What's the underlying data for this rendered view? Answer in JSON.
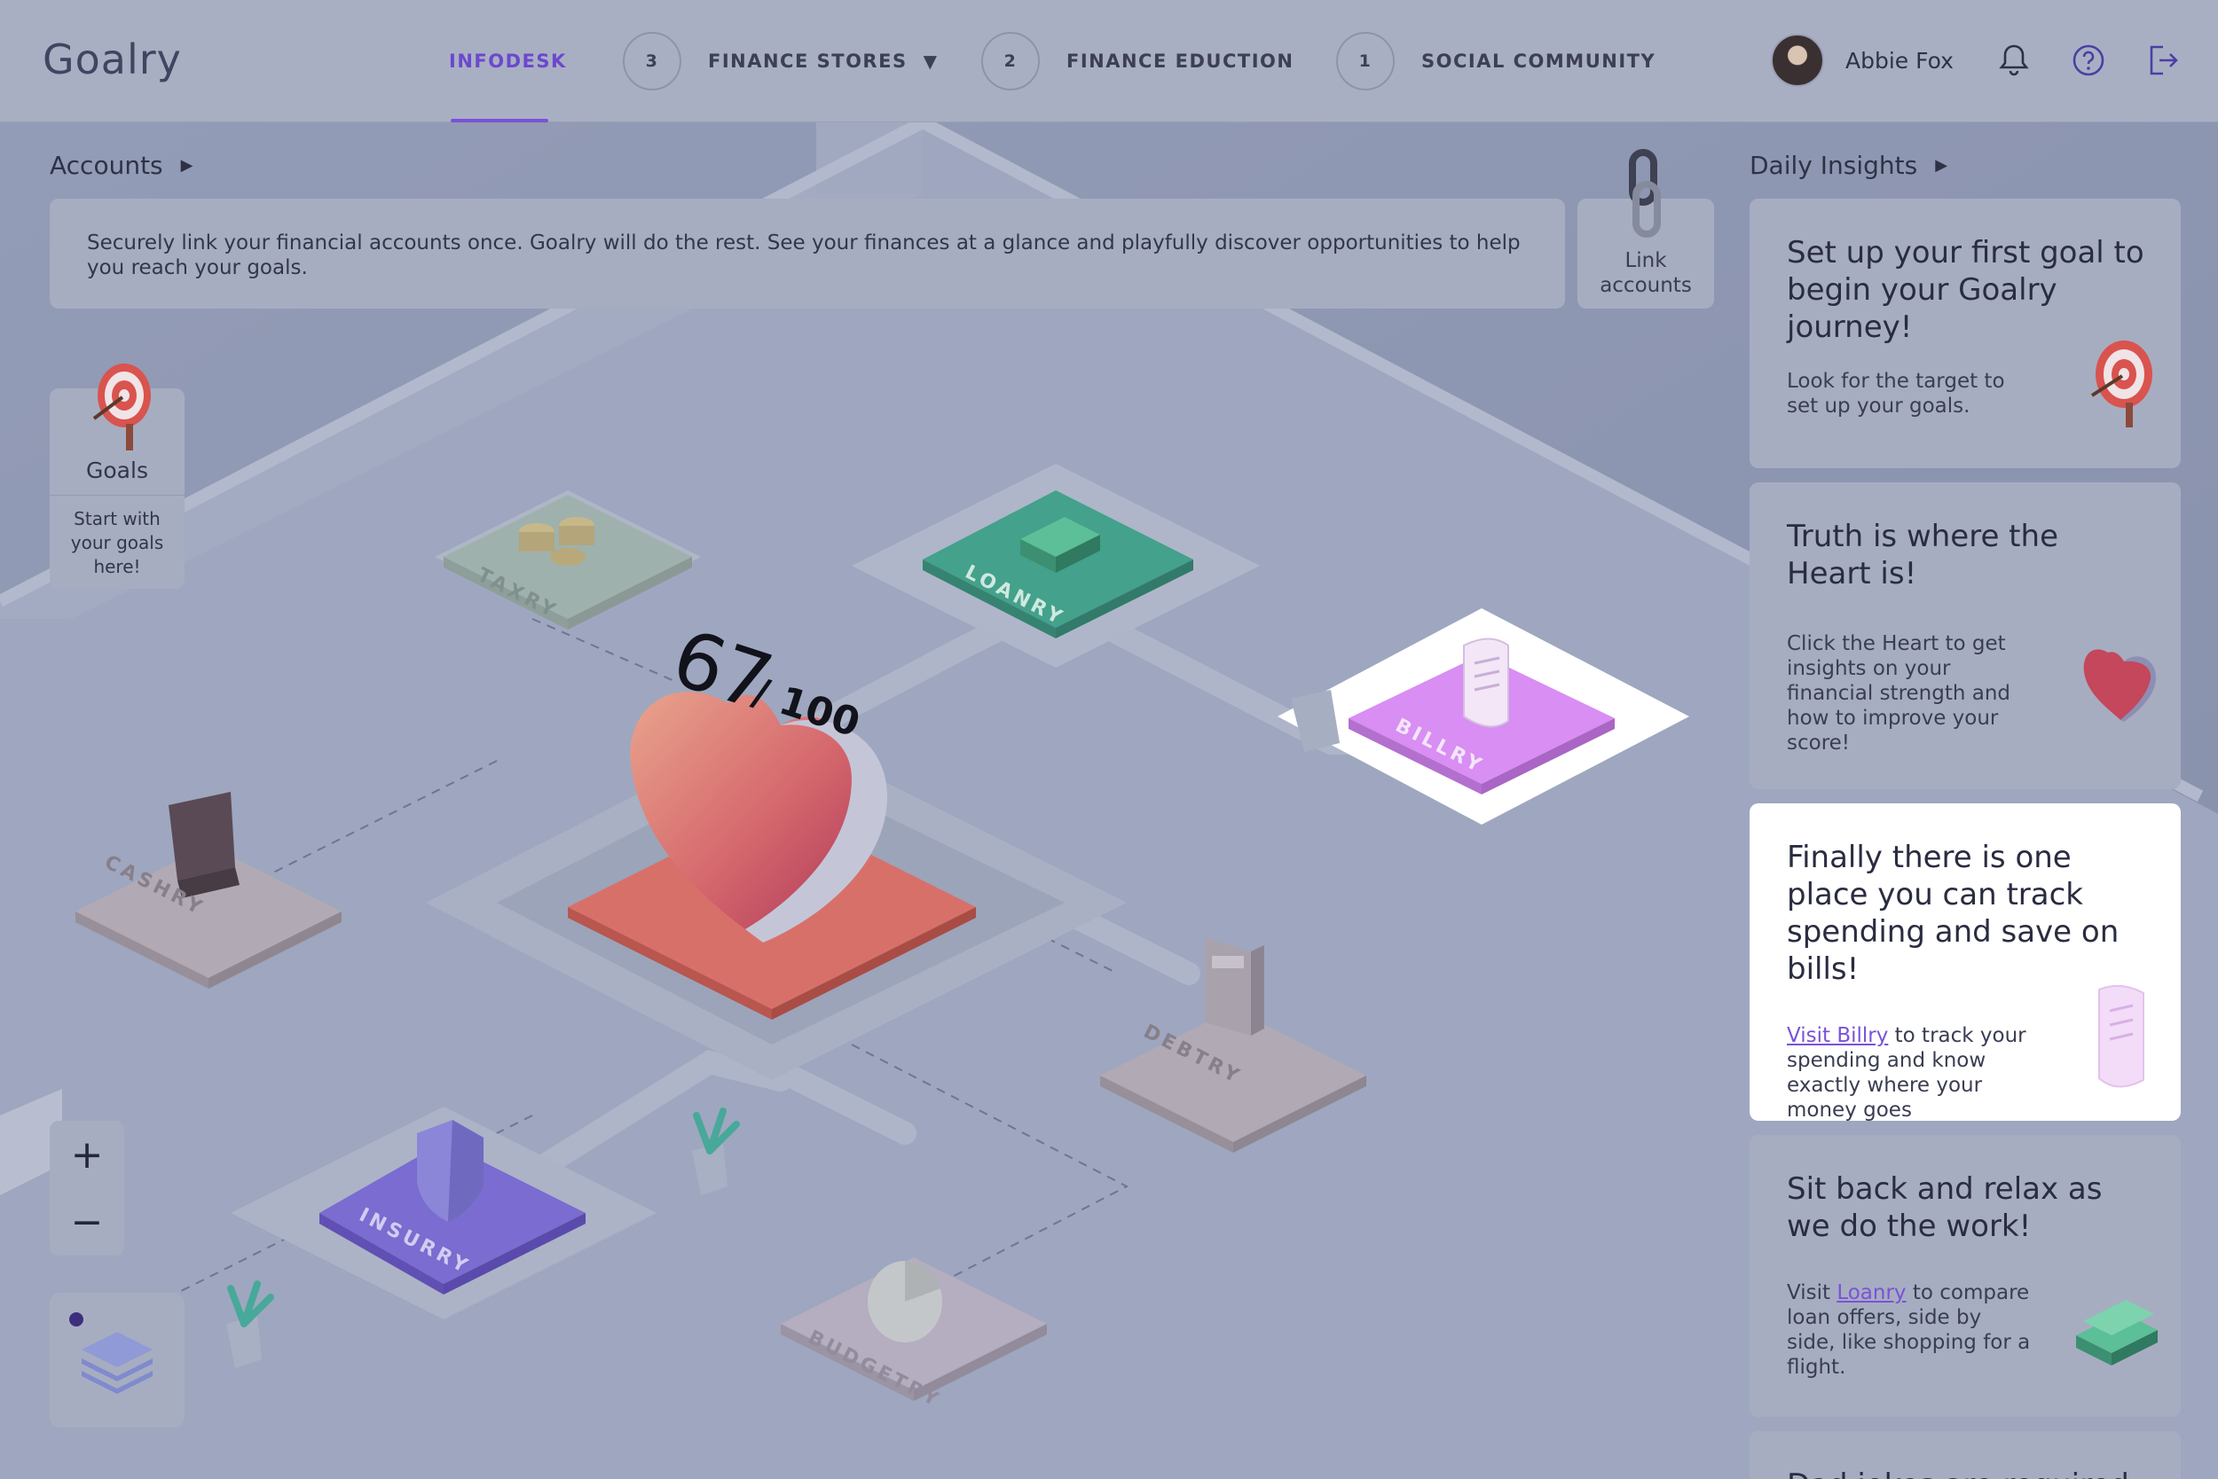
{
  "app": {
    "logo": "Goalry",
    "user_name": "Abbie Fox"
  },
  "nav": {
    "tabs": [
      {
        "label": "INFODESK",
        "active": true
      },
      {
        "label": "FINANCE STORES",
        "badge": "3",
        "has_dropdown": true
      },
      {
        "label": "FINANCE EDUCTION",
        "badge": "2"
      },
      {
        "label": "SOCIAL COMMUNITY",
        "badge": "1"
      }
    ]
  },
  "accounts": {
    "title": "Accounts",
    "description": "Securely link your financial accounts once. Goalry will do the rest. See your finances at a glance and playfully discover opportunities to help you reach your goals.",
    "link_label_line1": "Link",
    "link_label_line2": "accounts"
  },
  "goals_card": {
    "title": "Goals",
    "subtitle": "Start with your goals here!"
  },
  "score": {
    "value": "67",
    "separator": "/",
    "max": "100"
  },
  "tiles": [
    {
      "label": "TAXRY",
      "color": "#9fb1ad"
    },
    {
      "label": "LOANRY",
      "color": "#43a18c"
    },
    {
      "label": "BILLRY",
      "color": "#d88ef2"
    },
    {
      "label": "CASHRY",
      "color": "#ad9fad"
    },
    {
      "label": "DEBTRY",
      "color": "#ab9faa"
    },
    {
      "label": "INSURRY",
      "color": "#7a6cd0"
    },
    {
      "label": "BUDGETRY",
      "color": "#b8aabe"
    }
  ],
  "daily_insights": {
    "title": "Daily Insights",
    "cards": [
      {
        "title": "Set up your first goal to begin your Goalry journey!",
        "body": "Look for the target to set up your goals."
      },
      {
        "title": "Truth is where the Heart is!",
        "body": "Click the Heart to get insights on your financial strength and how to improve your score!"
      },
      {
        "title": "Finally there is one place you can track spending and save on bills!",
        "link": "Visit Billry",
        "body": " to track your spending and know exactly where your money goes"
      },
      {
        "title": "Sit back and relax as we do the work!",
        "pre": "Visit ",
        "link": "Loanry",
        "body": " to compare loan offers, side by side, like shopping for a flight."
      },
      {
        "title": "Dad jokes are required"
      }
    ]
  },
  "zoom": {
    "in": "+",
    "out": "−"
  },
  "colors": {
    "accent": "#7a52d8",
    "header_bg": "#a9afc3",
    "card_bg": "#a7adc1",
    "heart_base": "#d8706a"
  }
}
